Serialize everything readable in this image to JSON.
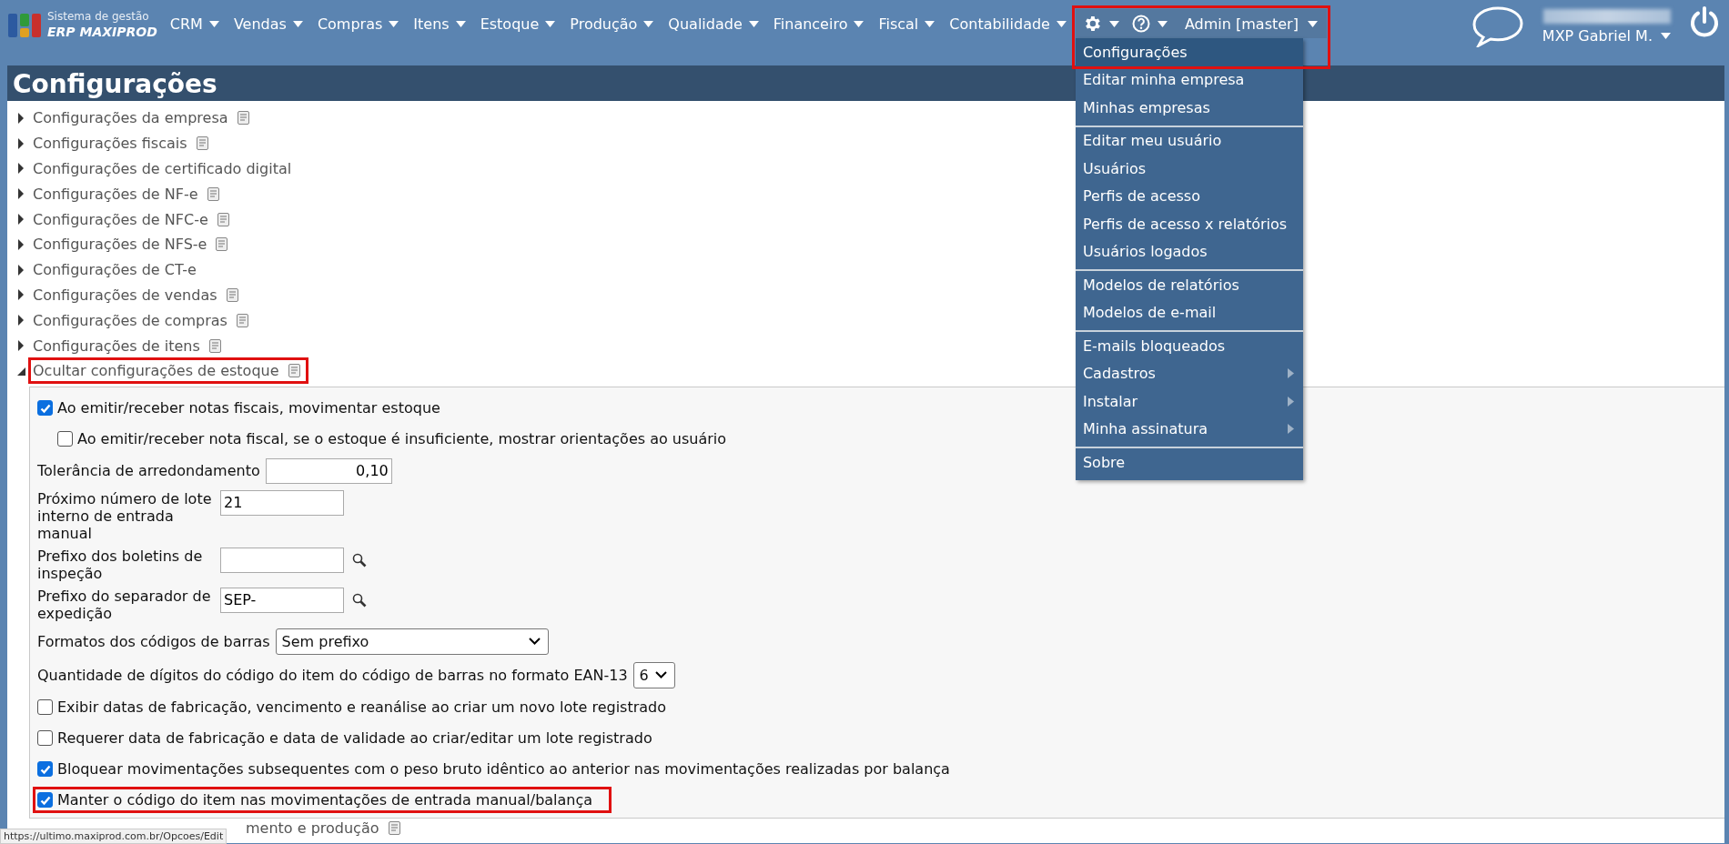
{
  "app": {
    "logo_line1": "Sistema de gestão",
    "logo_line2": "ERP MAXIPROD"
  },
  "nav": [
    {
      "label": "CRM"
    },
    {
      "label": "Vendas"
    },
    {
      "label": "Compras"
    },
    {
      "label": "Itens"
    },
    {
      "label": "Estoque"
    },
    {
      "label": "Produção"
    },
    {
      "label": "Qualidade"
    },
    {
      "label": "Financeiro"
    },
    {
      "label": "Fiscal"
    },
    {
      "label": "Contabilidade"
    }
  ],
  "tools": {
    "admin_label": "Admin [master]",
    "highlighted": true
  },
  "settings_menu": [
    {
      "label": "Configurações",
      "selected": true,
      "has_submenu": false,
      "divider_before": false
    },
    {
      "label": "Editar minha empresa",
      "selected": false,
      "has_submenu": false,
      "divider_before": false
    },
    {
      "label": "Minhas empresas",
      "selected": false,
      "has_submenu": false,
      "divider_before": false
    },
    {
      "label": "Editar meu usuário",
      "selected": false,
      "has_submenu": false,
      "divider_before": true
    },
    {
      "label": "Usuários",
      "selected": false,
      "has_submenu": false,
      "divider_before": false
    },
    {
      "label": "Perfis de acesso",
      "selected": false,
      "has_submenu": false,
      "divider_before": false
    },
    {
      "label": "Perfis de acesso x relatórios",
      "selected": false,
      "has_submenu": false,
      "divider_before": false
    },
    {
      "label": "Usuários logados",
      "selected": false,
      "has_submenu": false,
      "divider_before": false
    },
    {
      "label": "Modelos de relatórios",
      "selected": false,
      "has_submenu": false,
      "divider_before": true
    },
    {
      "label": "Modelos de e-mail",
      "selected": false,
      "has_submenu": false,
      "divider_before": false
    },
    {
      "label": "E-mails bloqueados",
      "selected": false,
      "has_submenu": false,
      "divider_before": true
    },
    {
      "label": "Cadastros",
      "selected": false,
      "has_submenu": true,
      "divider_before": false
    },
    {
      "label": "Instalar",
      "selected": false,
      "has_submenu": true,
      "divider_before": false
    },
    {
      "label": "Minha assinatura",
      "selected": false,
      "has_submenu": true,
      "divider_before": false
    },
    {
      "label": "Sobre",
      "selected": false,
      "has_submenu": false,
      "divider_before": true
    }
  ],
  "user": {
    "name": "MXP Gabriel M."
  },
  "page_title": "Configurações",
  "sections": [
    {
      "label": "Configurações da empresa",
      "has_doc": true,
      "expanded": false,
      "highlighted": false
    },
    {
      "label": "Configurações fiscais",
      "has_doc": true,
      "expanded": false,
      "highlighted": false
    },
    {
      "label": "Configurações de certificado digital",
      "has_doc": false,
      "expanded": false,
      "highlighted": false
    },
    {
      "label": "Configurações de NF-e",
      "has_doc": true,
      "expanded": false,
      "highlighted": false
    },
    {
      "label": "Configurações de NFC-e",
      "has_doc": true,
      "expanded": false,
      "highlighted": false
    },
    {
      "label": "Configurações de NFS-e",
      "has_doc": true,
      "expanded": false,
      "highlighted": false
    },
    {
      "label": "Configurações de CT-e",
      "has_doc": false,
      "expanded": false,
      "highlighted": false
    },
    {
      "label": "Configurações de vendas",
      "has_doc": true,
      "expanded": false,
      "highlighted": false
    },
    {
      "label": "Configurações de compras",
      "has_doc": true,
      "expanded": false,
      "highlighted": false
    },
    {
      "label": "Configurações de itens",
      "has_doc": true,
      "expanded": false,
      "highlighted": false
    },
    {
      "label": "Ocultar configurações de estoque",
      "has_doc": true,
      "expanded": true,
      "highlighted": true
    }
  ],
  "form": [
    {
      "kind": "checkbox",
      "label": "Ao emitir/receber notas fiscais, movimentar estoque",
      "checked": true,
      "highlighted": false,
      "children": [
        {
          "kind": "checkbox",
          "label": "Ao emitir/receber nota fiscal, se o estoque é insuficiente, mostrar orientações ao usuário",
          "checked": false,
          "highlighted": false
        }
      ]
    },
    {
      "kind": "number",
      "label": "Tolerância de arredondamento",
      "value": "0,10"
    },
    {
      "kind": "text",
      "label": "Próximo número de lote interno de entrada manual",
      "value": "21",
      "lookup": false
    },
    {
      "kind": "text",
      "label": "Prefixo dos boletins de inspeção",
      "lookup": true
    },
    {
      "kind": "text",
      "label": "Prefixo do separador de expedição",
      "value": "SEP-",
      "lookup": true
    },
    {
      "kind": "select",
      "label": "Formatos dos códigos de barras",
      "value": "Sem prefixo",
      "wide": true
    },
    {
      "kind": "select",
      "label": "Quantidade de dígitos do código do item do código de barras no formato EAN-13",
      "value": "6",
      "wide": false
    },
    {
      "kind": "checkbox",
      "label": "Exibir datas de fabricação, vencimento e reanálise ao criar um novo lote registrado",
      "checked": false,
      "highlighted": false
    },
    {
      "kind": "checkbox",
      "label": "Requerer data de fabricação e data de validade ao criar/editar um lote registrado",
      "checked": false,
      "highlighted": false
    },
    {
      "kind": "checkbox",
      "label": "Bloquear movimentações subsequentes com o peso bruto idêntico ao anterior nas movimentações realizadas por balança",
      "checked": true,
      "highlighted": false
    },
    {
      "kind": "checkbox",
      "label": "Manter o código do item nas movimentações de entrada manual/balança",
      "checked": true,
      "highlighted": true
    }
  ],
  "trailing_section": {
    "label": "mento e produção",
    "has_doc": true
  },
  "status_bar": {
    "url": "https://ultimo.maxiprod.com.br/Opcoes/Edit"
  }
}
